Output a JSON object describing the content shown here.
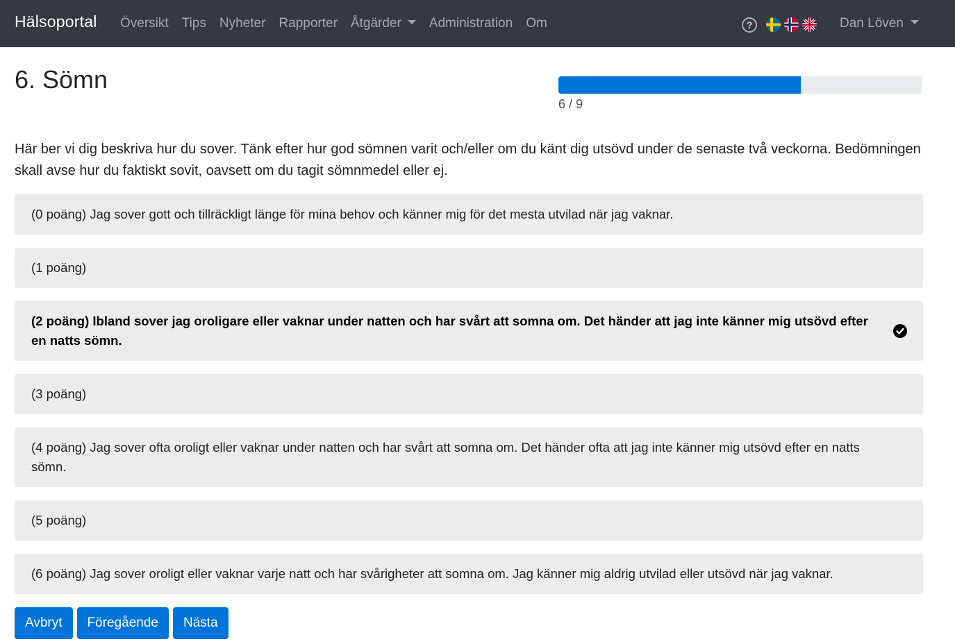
{
  "navbar": {
    "brand": "Hälsoportal",
    "links": [
      "Översikt",
      "Tips",
      "Nyheter",
      "Rapporter",
      "Åtgärder",
      "Administration",
      "Om"
    ],
    "help_icon": "question-circle-icon",
    "flags": [
      "sweden-flag-icon",
      "norway-flag-icon",
      "uk-flag-icon"
    ],
    "user": "Dan Löven"
  },
  "page": {
    "title": "6. Sömn",
    "progress": {
      "current": 6,
      "total": 9,
      "label": "6 / 9",
      "color": "#0074d9"
    },
    "intro": "Här ber vi dig beskriva hur du sover. Tänk efter hur god sömnen varit och/eller om du känt dig utsövd under de senaste två veckorna. Bedömningen skall avse hur du faktiskt sovit, oavsett om du tagit sömnmedel eller ej."
  },
  "options": [
    {
      "text": "(0 poäng) Jag sover gott och tillräckligt länge för mina behov och känner mig för det mesta utvilad när jag vaknar.",
      "selected": false
    },
    {
      "text": "(1 poäng)",
      "selected": false
    },
    {
      "text": "(2 poäng) Ibland sover jag oroligare eller vaknar under natten och har svårt att somna om. Det händer att jag inte känner mig utsövd efter en natts sömn.",
      "selected": true
    },
    {
      "text": "(3 poäng)",
      "selected": false
    },
    {
      "text": "(4 poäng) Jag sover ofta oroligt eller vaknar under natten och har svårt att somna om. Det händer ofta att jag inte känner mig utsövd efter en natts sömn.",
      "selected": false
    },
    {
      "text": "(5 poäng)",
      "selected": false
    },
    {
      "text": "(6 poäng) Jag sover oroligt eller vaknar varje natt och har svårigheter att somna om. Jag känner mig aldrig utvilad eller utsövd när jag vaknar.",
      "selected": false
    }
  ],
  "buttons": {
    "cancel": "Avbryt",
    "previous": "Föregående",
    "next": "Nästa"
  }
}
